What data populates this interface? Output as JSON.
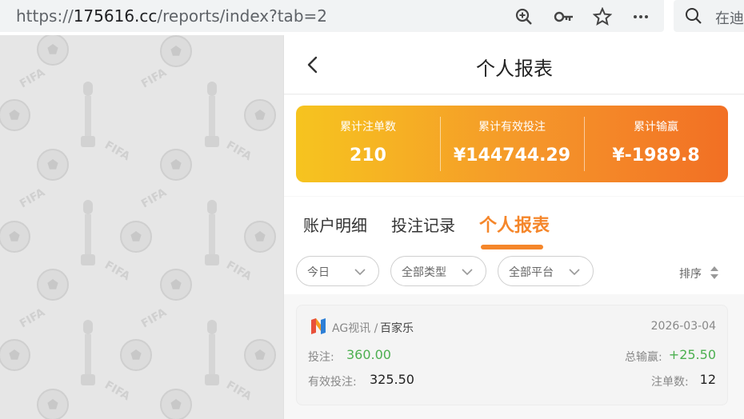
{
  "browser": {
    "url_prefix": "https://",
    "url_host": "175616.cc",
    "url_path": "/reports/index?tab=2",
    "search_placeholder": "在迪"
  },
  "header": {
    "title": "个人报表"
  },
  "summary": {
    "items": [
      {
        "label": "累计注单数",
        "value": "210"
      },
      {
        "label": "累计有效投注",
        "value": "¥144744.29"
      },
      {
        "label": "累计输赢",
        "value": "¥-1989.8"
      }
    ],
    "gradient_colors": [
      "#f6c41f",
      "#f5962a",
      "#f26f24"
    ]
  },
  "tabs": [
    {
      "label": "账户明细",
      "active": false
    },
    {
      "label": "投注记录",
      "active": false
    },
    {
      "label": "个人报表",
      "active": true
    }
  ],
  "accent_color": "#f5862a",
  "filters": {
    "date": "今日",
    "type": "全部类型",
    "platform": "全部平台",
    "sort_label": "排序"
  },
  "records": [
    {
      "platform": "AG视讯 /",
      "game": "百家乐",
      "date": "2026-03-04",
      "bet_label": "投注:",
      "bet_value": "360.00",
      "win_label": "总输赢:",
      "win_value": "+25.50",
      "valid_label": "有效投注:",
      "valid_value": "325.50",
      "count_label": "注单数:",
      "count_value": "12"
    }
  ]
}
